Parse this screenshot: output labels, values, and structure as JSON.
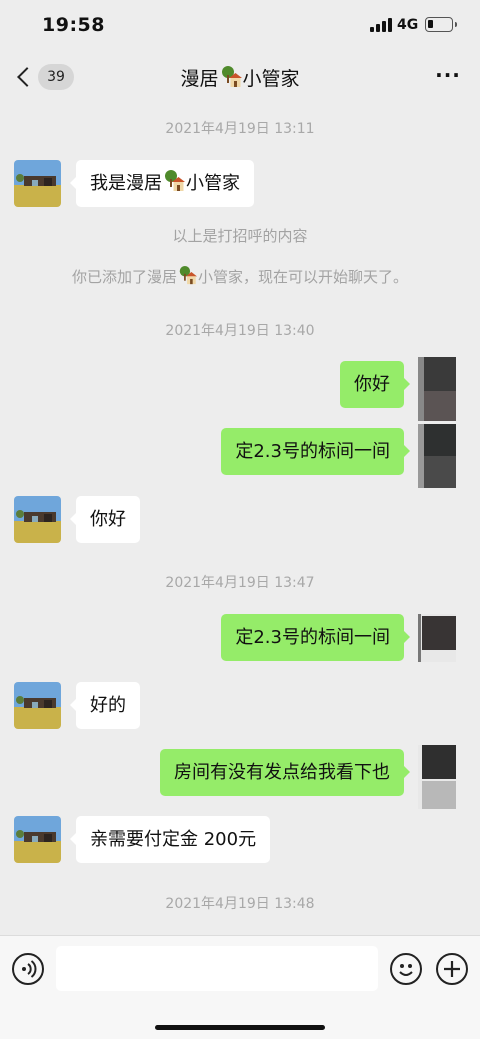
{
  "status_bar": {
    "time": "19:58",
    "network": "4G"
  },
  "nav": {
    "unread_count": "39",
    "title_part1": "漫居",
    "title_part2": "小管家",
    "more": "···"
  },
  "messages": {
    "ts1": "2021年4月19日 13:11",
    "greet_part1": "我是漫居",
    "greet_part2": "小管家",
    "sys1": "以上是打招呼的内容",
    "sys2_part1": "你已添加了漫居",
    "sys2_part2": "小管家，现在可以开始聊天了。",
    "ts2": "2021年4月19日 13:40",
    "out1": "你好",
    "out2": "定2.3号的标间一间",
    "in1": "你好",
    "ts3": "2021年4月19日 13:47",
    "out3": "定2.3号的标间一间",
    "in2": "好的",
    "out4": "房间有没有发点给我看下也",
    "in3": "亲需要付定金 200元",
    "ts4": "2021年4月19日 13:48"
  },
  "input": {
    "placeholder": ""
  },
  "icons": {
    "back": "chevron-left-icon",
    "more": "more-dots-icon",
    "voice": "voice-icon",
    "emoji": "emoji-icon",
    "add": "plus-icon",
    "title_emoji": "house-with-tree-emoji"
  },
  "colors": {
    "outgoing_bubble": "#95ec69",
    "incoming_bubble": "#ffffff",
    "background": "#ededed"
  }
}
